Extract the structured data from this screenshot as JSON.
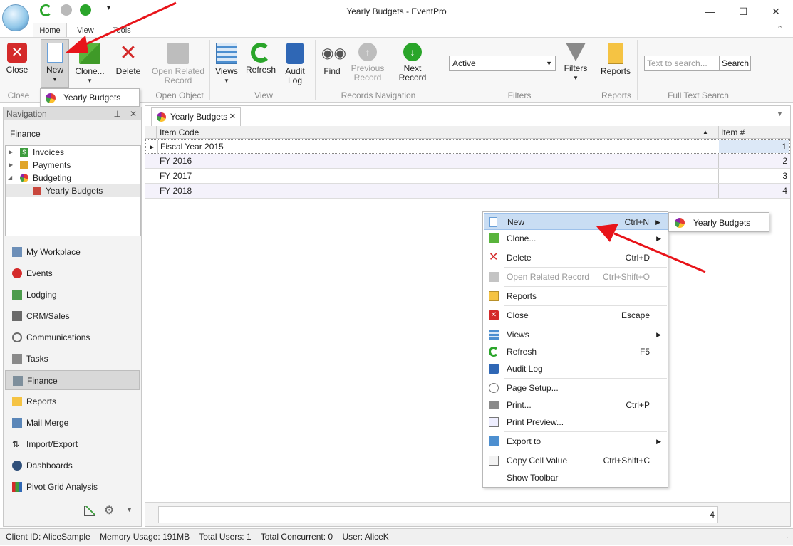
{
  "window": {
    "title": "Yearly Budgets - EventPro"
  },
  "ribbon_tabs": [
    "Home",
    "View",
    "Tools"
  ],
  "ribbon": {
    "close": "Close",
    "new": "New",
    "clone": "Clone...",
    "delete": "Delete",
    "open_related_line1": "Open Related",
    "open_related_line2": "Record",
    "views": "Views",
    "refresh": "Refresh",
    "audit_line1": "Audit",
    "audit_line2": "Log",
    "find": "Find",
    "previous_line1": "Previous",
    "previous_line2": "Record",
    "next_record": "Next Record",
    "filter_value": "Active",
    "filters": "Filters",
    "reports": "Reports",
    "search_placeholder": "Text to search...",
    "search_button": "Search",
    "groups": [
      "Close",
      "Open Object",
      "View",
      "Records Navigation",
      "Filters",
      "Reports",
      "Full Text Search"
    ]
  },
  "new_dropdown": {
    "item": "Yearly Budgets"
  },
  "navigation": {
    "header": "Navigation",
    "section": "Finance",
    "tree": [
      {
        "label": "Invoices"
      },
      {
        "label": "Payments"
      },
      {
        "label": "Budgeting"
      },
      {
        "label": "Yearly Budgets"
      }
    ],
    "items": [
      "My Workplace",
      "Events",
      "Lodging",
      "CRM/Sales",
      "Communications",
      "Tasks",
      "Finance",
      "Reports",
      "Mail Merge",
      "Import/Export",
      "Dashboards",
      "Pivot Grid Analysis"
    ]
  },
  "document_tab": {
    "label": "Yearly Budgets"
  },
  "grid": {
    "columns": [
      "Item Code",
      "Item #"
    ],
    "rows": [
      {
        "code": "Fiscal Year 2015",
        "num": "1"
      },
      {
        "code": "FY 2016",
        "num": "2"
      },
      {
        "code": "FY 2017",
        "num": "3"
      },
      {
        "code": "FY 2018",
        "num": "4"
      }
    ],
    "footer_count": "4"
  },
  "context_menu": {
    "items": [
      {
        "label": "New",
        "shortcut": "Ctrl+N"
      },
      {
        "label": "Clone...",
        "shortcut": ""
      },
      {
        "label": "Delete",
        "shortcut": "Ctrl+D"
      },
      {
        "label": "Open Related Record",
        "shortcut": "Ctrl+Shift+O"
      },
      {
        "label": "Reports",
        "shortcut": ""
      },
      {
        "label": "Close",
        "shortcut": "Escape"
      },
      {
        "label": "Views",
        "shortcut": ""
      },
      {
        "label": "Refresh",
        "shortcut": "F5"
      },
      {
        "label": "Audit Log",
        "shortcut": ""
      },
      {
        "label": "Page Setup...",
        "shortcut": ""
      },
      {
        "label": "Print...",
        "shortcut": "Ctrl+P"
      },
      {
        "label": "Print Preview...",
        "shortcut": ""
      },
      {
        "label": "Export to",
        "shortcut": ""
      },
      {
        "label": "Copy Cell Value",
        "shortcut": "Ctrl+Shift+C"
      },
      {
        "label": "Show Toolbar",
        "shortcut": ""
      }
    ],
    "submenu_item": "Yearly Budgets"
  },
  "status": {
    "client": "Client ID: AliceSample",
    "memory": "Memory Usage: 191MB",
    "users": "Total Users: 1",
    "concurrent": "Total Concurrent: 0",
    "user": "User: AliceK"
  },
  "colors": {
    "accent": "#2b78c5",
    "annotation_arrow": "#e8141a",
    "selection": "#dce8f7"
  }
}
